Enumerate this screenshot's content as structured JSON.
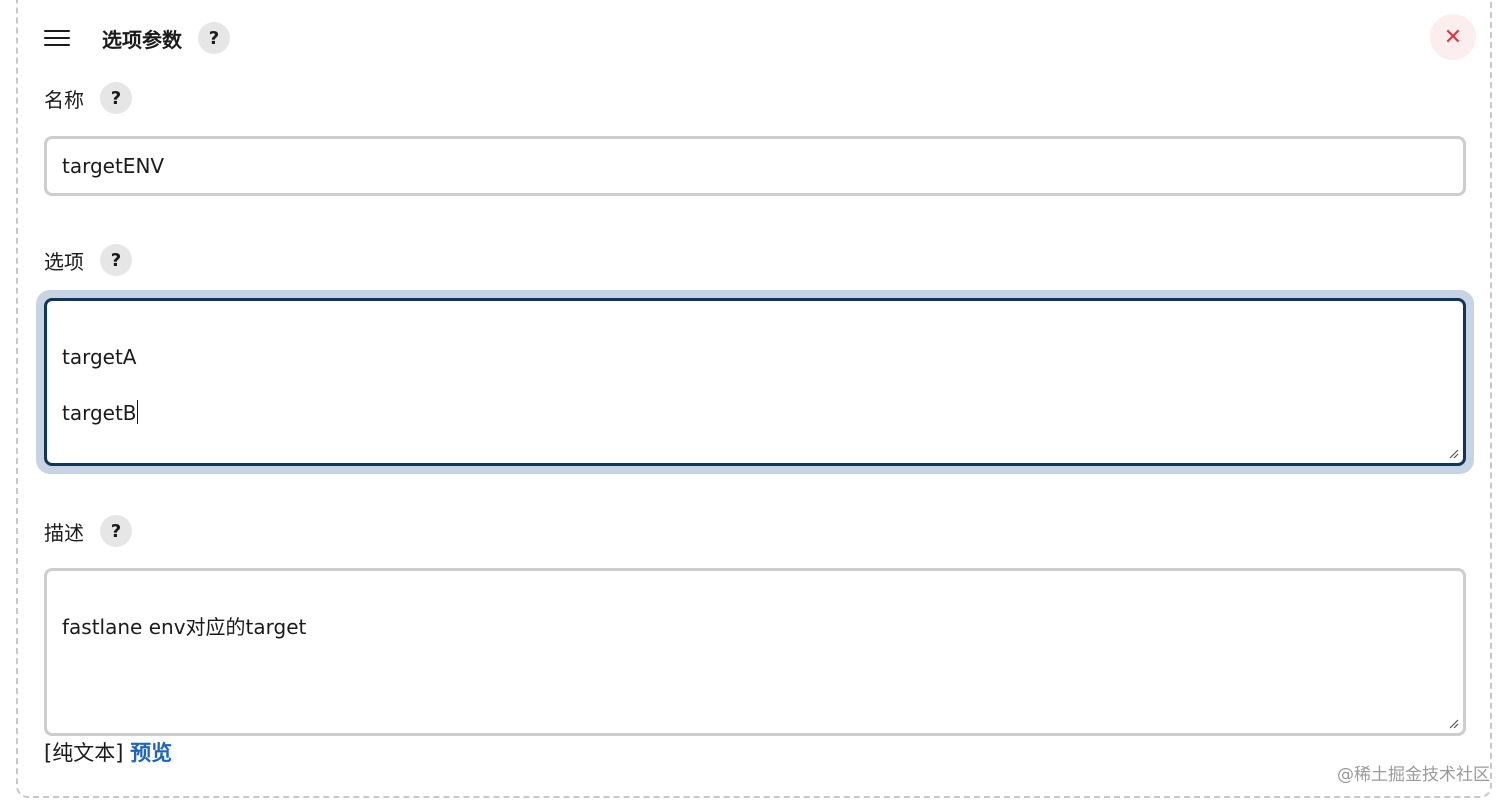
{
  "header": {
    "title": "选项参数",
    "help_label": "?",
    "close_label": "✕"
  },
  "fields": {
    "name": {
      "label": "名称",
      "help_label": "?",
      "value": "targetENV"
    },
    "choices": {
      "label": "选项",
      "help_label": "?",
      "lines": [
        "targetA",
        "targetB"
      ]
    },
    "description": {
      "label": "描述",
      "help_label": "?",
      "value": "fastlane env对应的target"
    }
  },
  "footer": {
    "plain_text_label": "[纯文本]",
    "preview_label": "预览"
  },
  "watermark": "@稀土掘金技术社区",
  "colors": {
    "focus_border": "#14355a",
    "focus_ring": "#c6d4e3",
    "close_icon": "#e0383f",
    "link": "#1d63c9"
  }
}
